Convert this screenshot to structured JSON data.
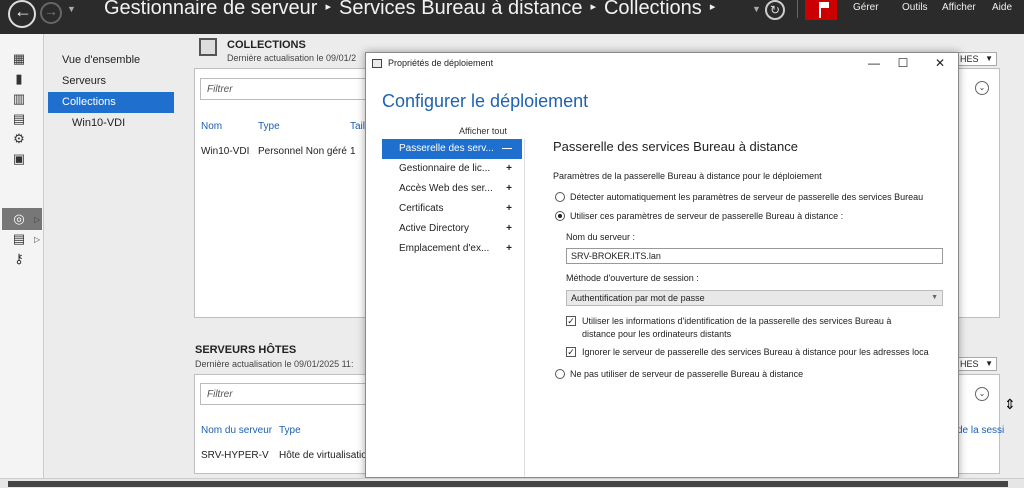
{
  "titlebar": {
    "breadcrumb": [
      "Gestionnaire de serveur",
      "Services Bureau à distance",
      "Collections"
    ],
    "separator": "▸",
    "menus": [
      "Gérer",
      "Outils",
      "Afficher",
      "Aide"
    ]
  },
  "sidebar": {
    "items": [
      {
        "label": "Vue d'ensemble"
      },
      {
        "label": "Serveurs"
      },
      {
        "label": "Collections"
      },
      {
        "label": "Win10-VDI"
      }
    ]
  },
  "collections": {
    "title": "COLLECTIONS",
    "subtitle": "Dernière actualisation le 09/01/2",
    "taches": "HES",
    "filter_placeholder": "Filtrer",
    "columns": [
      "Nom",
      "Type",
      "Tail"
    ],
    "rows": [
      {
        "nom": "Win10-VDI",
        "type": "Personnel Non géré",
        "taille": "1"
      }
    ]
  },
  "hosts": {
    "title": "SERVEURS HÔTES",
    "subtitle": "Dernière actualisation le 09/01/2025 11:",
    "taches": "HES",
    "filter_placeholder": "Filtrer",
    "columns": [
      "Nom du serveur",
      "Type"
    ],
    "right_header": "de la sessi",
    "rows": [
      {
        "nom": "SRV-HYPER-V",
        "type": "Hôte de virtualisatio"
      }
    ]
  },
  "dialog": {
    "title": "Propriétés de déploiement",
    "heading": "Configurer le déploiement",
    "show_all": "Afficher tout",
    "nav": [
      {
        "label": "Passerelle des serv...",
        "sign": "—"
      },
      {
        "label": "Gestionnaire de lic...",
        "sign": "+"
      },
      {
        "label": "Accès Web des ser...",
        "sign": "+"
      },
      {
        "label": "Certificats",
        "sign": "+"
      },
      {
        "label": "Active Directory",
        "sign": "+"
      },
      {
        "label": "Emplacement d'ex...",
        "sign": "+"
      }
    ],
    "content": {
      "title": "Passerelle des services Bureau à distance",
      "intro": "Paramètres de la passerelle Bureau à distance pour le déploiement",
      "radio_auto": "Détecter automatiquement les paramètres de serveur de passerelle des services Bureau",
      "radio_use": "Utiliser ces paramètres de serveur de passerelle Bureau à distance :",
      "server_label": "Nom du serveur :",
      "server_value": "SRV-BROKER.ITS.lan",
      "logon_label": "Méthode d'ouverture de session :",
      "logon_value": "Authentification par mot de passe",
      "chk1_line1": "Utiliser les informations d'identification de la passerelle des services Bureau à",
      "chk1_line2": "distance pour les ordinateurs distants",
      "chk2": "Ignorer le serveur de passerelle des services Bureau à distance pour les adresses loca",
      "radio_none": "Ne pas utiliser de serveur de passerelle Bureau à distance"
    }
  }
}
